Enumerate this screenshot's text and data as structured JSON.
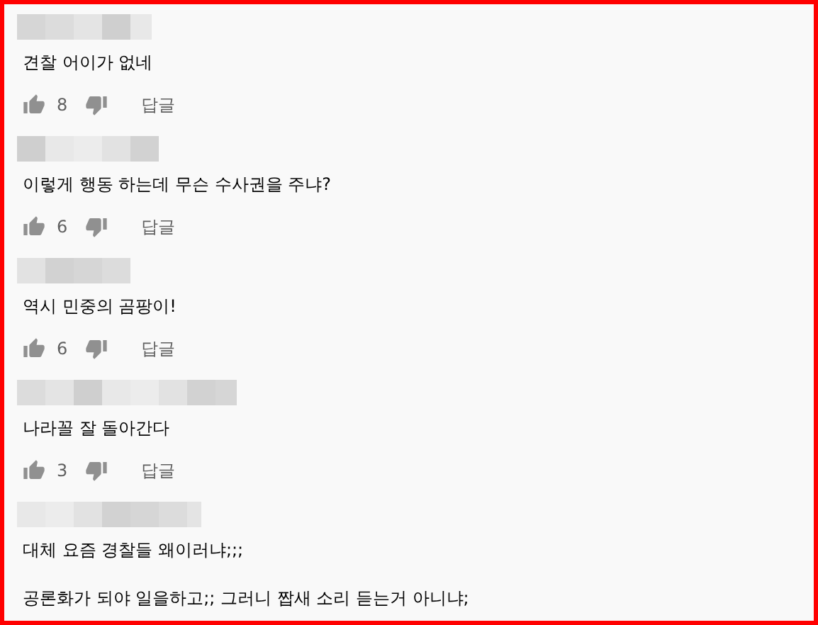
{
  "comments": [
    {
      "lines": [
        "견찰 어이가 없네"
      ],
      "likes": "8",
      "reply": "답글"
    },
    {
      "lines": [
        "이렇게  행동 하는데 무슨 수사권을 주냐?"
      ],
      "likes": "6",
      "reply": "답글"
    },
    {
      "lines": [
        "역시 민중의 곰팡이!"
      ],
      "likes": "6",
      "reply": "답글"
    },
    {
      "lines": [
        "나라꼴 잘 돌아간다"
      ],
      "likes": "3",
      "reply": "답글"
    },
    {
      "lines": [
        "대체 요즘 경찰들 왜이러냐;;;",
        "공론화가 되야 일을하고;; 그러니 짭새 소리 듣는거 아니냐;"
      ]
    }
  ]
}
